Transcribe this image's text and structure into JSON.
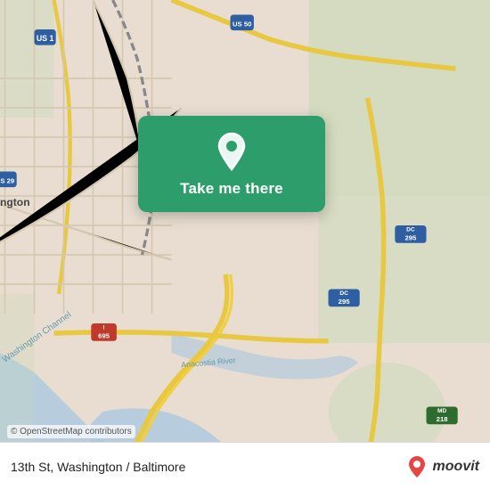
{
  "map": {
    "attribution": "© OpenStreetMap contributors",
    "bg_color": "#e8ddd0"
  },
  "card": {
    "button_label": "Take me there",
    "pin_icon": "map-pin-icon"
  },
  "bottom_bar": {
    "address": "13th St, Washington / Baltimore",
    "logo_text": "moovit"
  }
}
